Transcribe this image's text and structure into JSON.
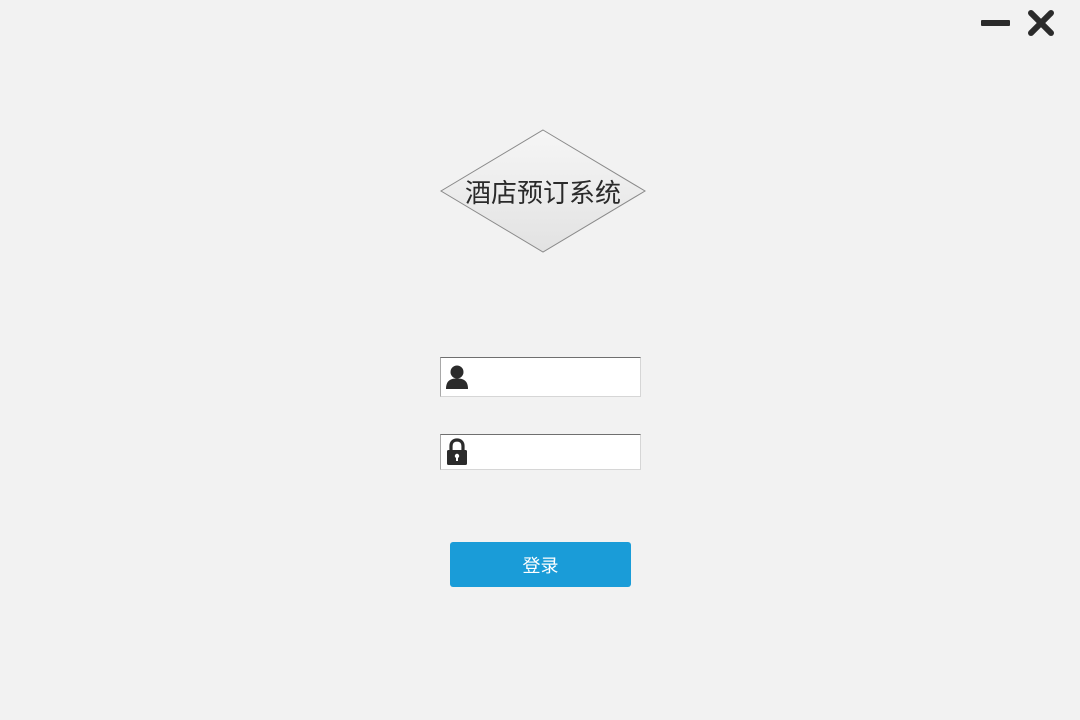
{
  "app": {
    "title": "酒店预订系统"
  },
  "window_controls": {
    "minimize_icon": "minimize-icon",
    "close_icon": "close-icon"
  },
  "login_form": {
    "username": {
      "icon": "user-icon",
      "value": "",
      "placeholder": ""
    },
    "password": {
      "icon": "lock-icon",
      "value": "",
      "placeholder": ""
    },
    "submit_label": "登录"
  },
  "colors": {
    "background": "#f2f2f2",
    "accent": "#1a9cd8",
    "icon": "#2b2b2b"
  }
}
